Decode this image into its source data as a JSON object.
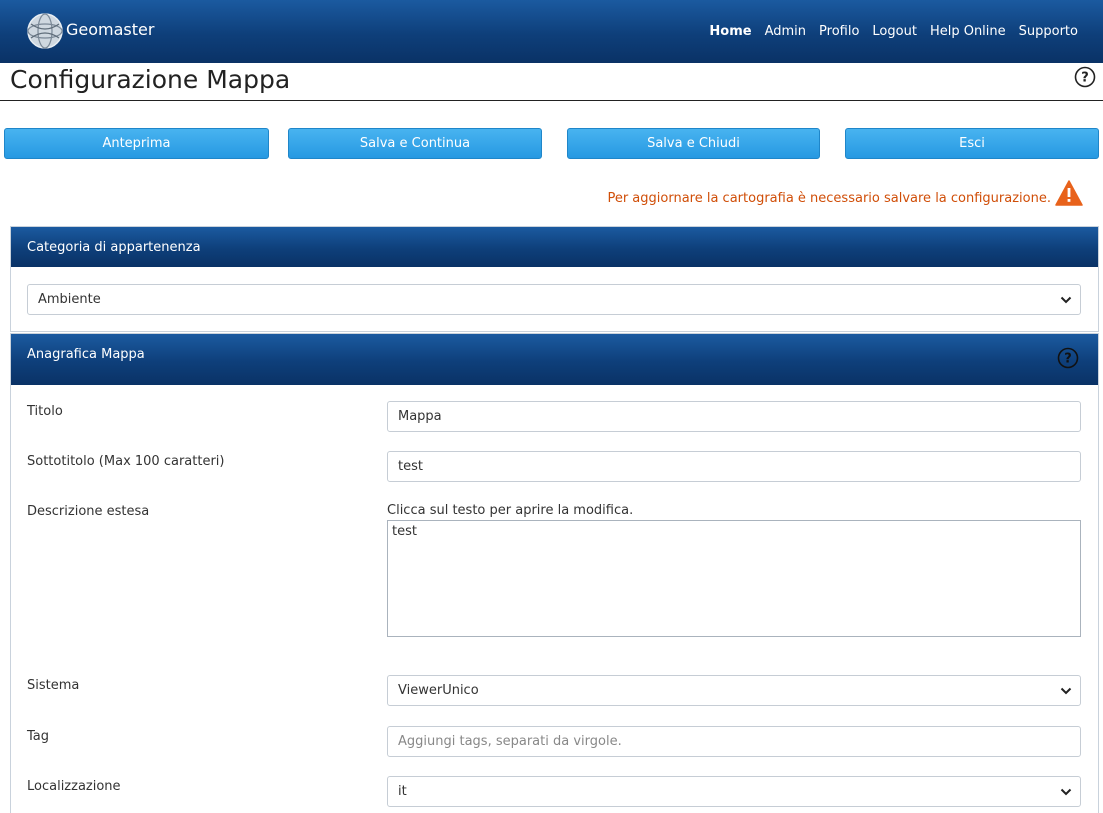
{
  "brand": {
    "name": "Geomaster"
  },
  "nav": [
    "Home",
    "Admin",
    "Profilo",
    "Logout",
    "Help Online",
    "Supporto"
  ],
  "page": {
    "title": "Configurazione Mappa"
  },
  "actions": {
    "preview": "Anteprima",
    "save_continue": "Salva e Continua",
    "save_close": "Salva e Chiudi",
    "exit": "Esci"
  },
  "warning": {
    "text": "Per aggiornare la cartografia è necessario salvare la configurazione.",
    "color": "#d04e08"
  },
  "category_panel": {
    "title": "Categoria di appartenenza",
    "selected": "Ambiente"
  },
  "map_panel": {
    "title": "Anagrafica Mappa",
    "fields": {
      "titolo": {
        "label": "Titolo",
        "value": "Mappa"
      },
      "sottotitolo": {
        "label": "Sottotitolo (Max 100 caratteri)",
        "value": "test"
      },
      "descrizione": {
        "label": "Descrizione estesa",
        "hint": "Clicca sul testo per aprire la modifica.",
        "value": "test"
      },
      "sistema": {
        "label": "Sistema",
        "selected": "ViewerUnico"
      },
      "tag": {
        "label": "Tag",
        "placeholder": "Aggiungi tags, separati da virgole."
      },
      "localizzazione": {
        "label": "Localizzazione",
        "selected": "it"
      }
    }
  },
  "colors": {
    "header_blue": "#0e3f7a",
    "button_blue": "#2699e2"
  }
}
